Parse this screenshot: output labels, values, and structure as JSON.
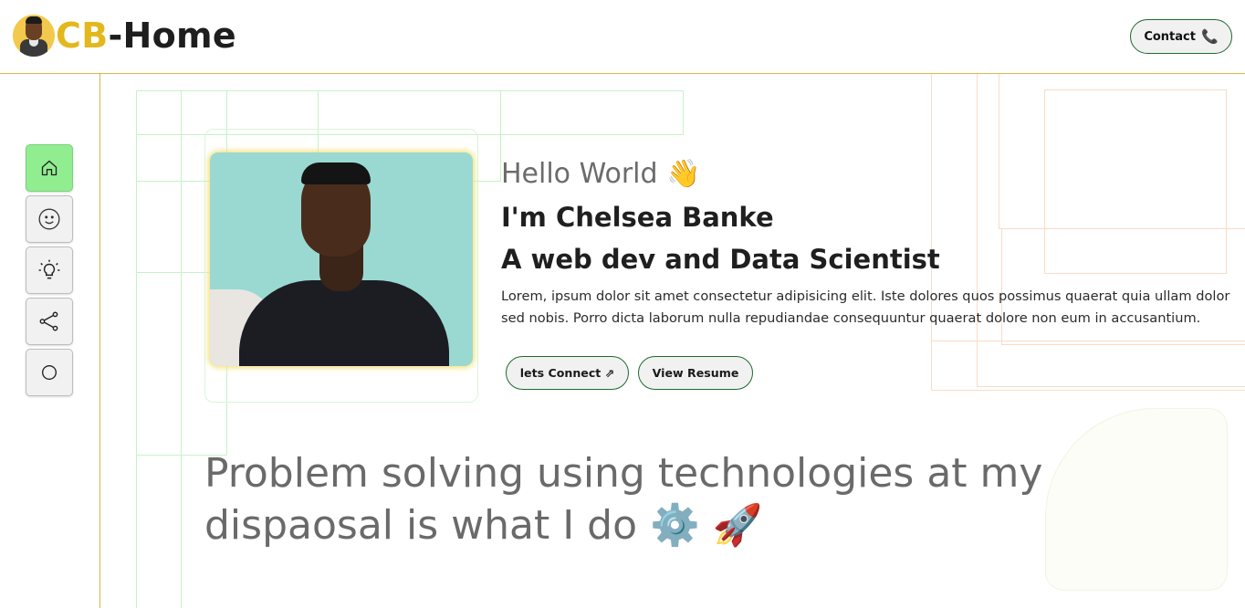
{
  "header": {
    "logo_prefix": "CB",
    "logo_suffix": "-Home",
    "contact_label": "Contact",
    "contact_icon": "phone-icon"
  },
  "sidebar": {
    "items": [
      {
        "id": "home",
        "icon": "home-icon",
        "active": true
      },
      {
        "id": "about",
        "icon": "smiley-icon",
        "active": false
      },
      {
        "id": "skills",
        "icon": "lightbulb-icon",
        "active": false
      },
      {
        "id": "share",
        "icon": "share-icon",
        "active": false
      },
      {
        "id": "other",
        "icon": "circle-icon",
        "active": false
      }
    ]
  },
  "hero": {
    "greeting": "Hello World 👋",
    "name": "I'm Chelsea Banke",
    "role": "A web dev and Data Scientist",
    "bio": "Lorem, ipsum dolor sit amet consectetur adipisicing elit. Iste dolores quos possimus quaerat quia ullam dolor sed nobis. Porro dicta laborum nulla repudiandae consequuntur quaerat dolore non eum in accusantium.",
    "connect_label": "lets Connect ⇗",
    "resume_label": "View Resume"
  },
  "tagline": {
    "text": "Problem solving using technologies at my dispaosal is what I do ⚙️ 🚀"
  },
  "colors": {
    "brand_yellow": "#e2b81d",
    "accent_green": "#1d6b2d",
    "active_nav": "#90ee90"
  }
}
